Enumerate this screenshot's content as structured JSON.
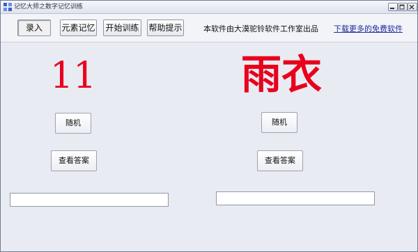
{
  "window": {
    "title": "记忆大师之数字记忆训练",
    "icon": "app-icon",
    "controls": [
      "minimize-icon",
      "maximize-icon",
      "close-icon"
    ]
  },
  "toolbar": {
    "buttons": [
      {
        "label": "录入",
        "pressed": true
      },
      {
        "label": "元素记忆",
        "pressed": false
      },
      {
        "label": "开始训练",
        "pressed": false
      },
      {
        "label": "帮助提示",
        "pressed": false
      }
    ],
    "notice": "本软件由大漠驼铃软件工作室出品",
    "link": "下载更多的免费软件"
  },
  "left_panel": {
    "number": "11",
    "random_label": "随机",
    "answer_label": "查看答案",
    "input_value": ""
  },
  "right_panel": {
    "word": "雨衣",
    "random_label": "随机",
    "answer_label": "查看答案",
    "input_value": ""
  },
  "colors": {
    "accent_red": "#e8001c",
    "link_blue": "#1a2a9c",
    "background": "#e9ebf3"
  }
}
